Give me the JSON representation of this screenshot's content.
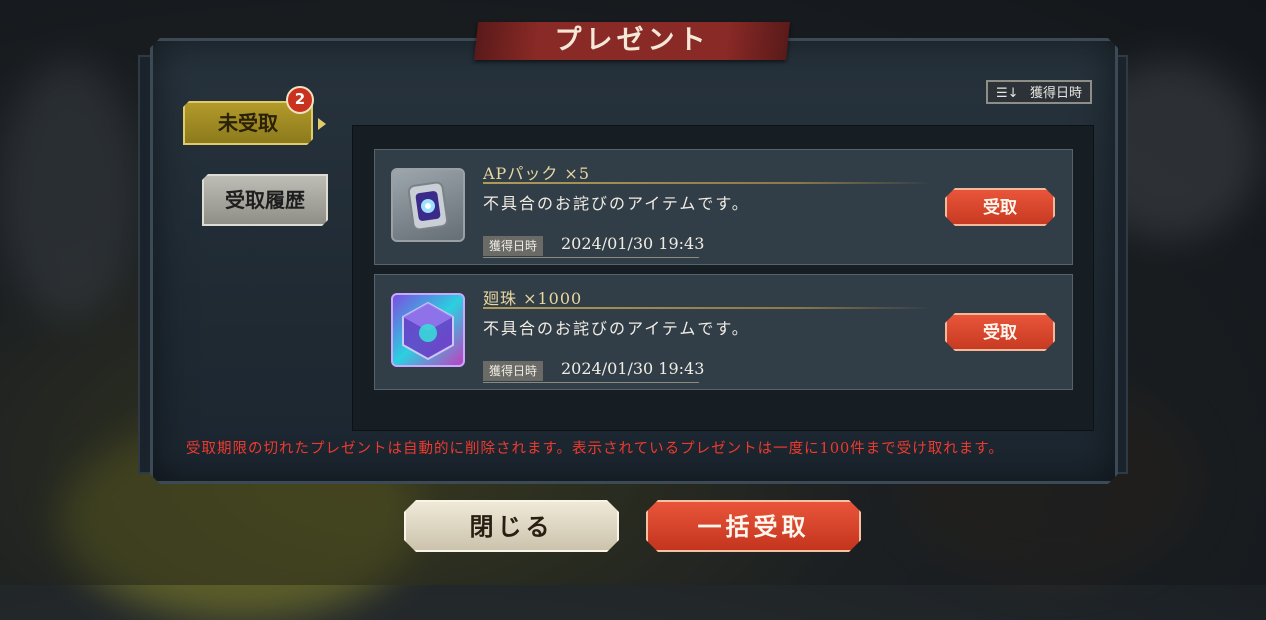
{
  "dialog": {
    "title": "プレゼント"
  },
  "tabs": {
    "unreceived": {
      "label": "未受取",
      "badge": "2"
    },
    "history": {
      "label": "受取履歴"
    }
  },
  "sort": {
    "icon": "sort-icon",
    "label": "獲得日時"
  },
  "items": [
    {
      "name": "APパック ×5",
      "description": "不具合のお詫びのアイテムです。",
      "date_label": "獲得日時",
      "date": "2024/01/30 19:43",
      "receive_label": "受取",
      "icon": "ap-pack-icon"
    },
    {
      "name": "廻珠 ×1000",
      "description": "不具合のお詫びのアイテムです。",
      "date_label": "獲得日時",
      "date": "2024/01/30 19:43",
      "receive_label": "受取",
      "icon": "gem-cube-icon"
    }
  ],
  "notice": "受取期限の切れたプレゼントは自動的に削除されます。表示されているプレゼントは一度に100件まで受け取れます。",
  "footer": {
    "close_label": "閉じる",
    "receive_all_label": "一括受取"
  },
  "colors": {
    "accent_red": "#d8432a",
    "gold": "#b29a2a",
    "notice_red": "#ee3a2e"
  }
}
